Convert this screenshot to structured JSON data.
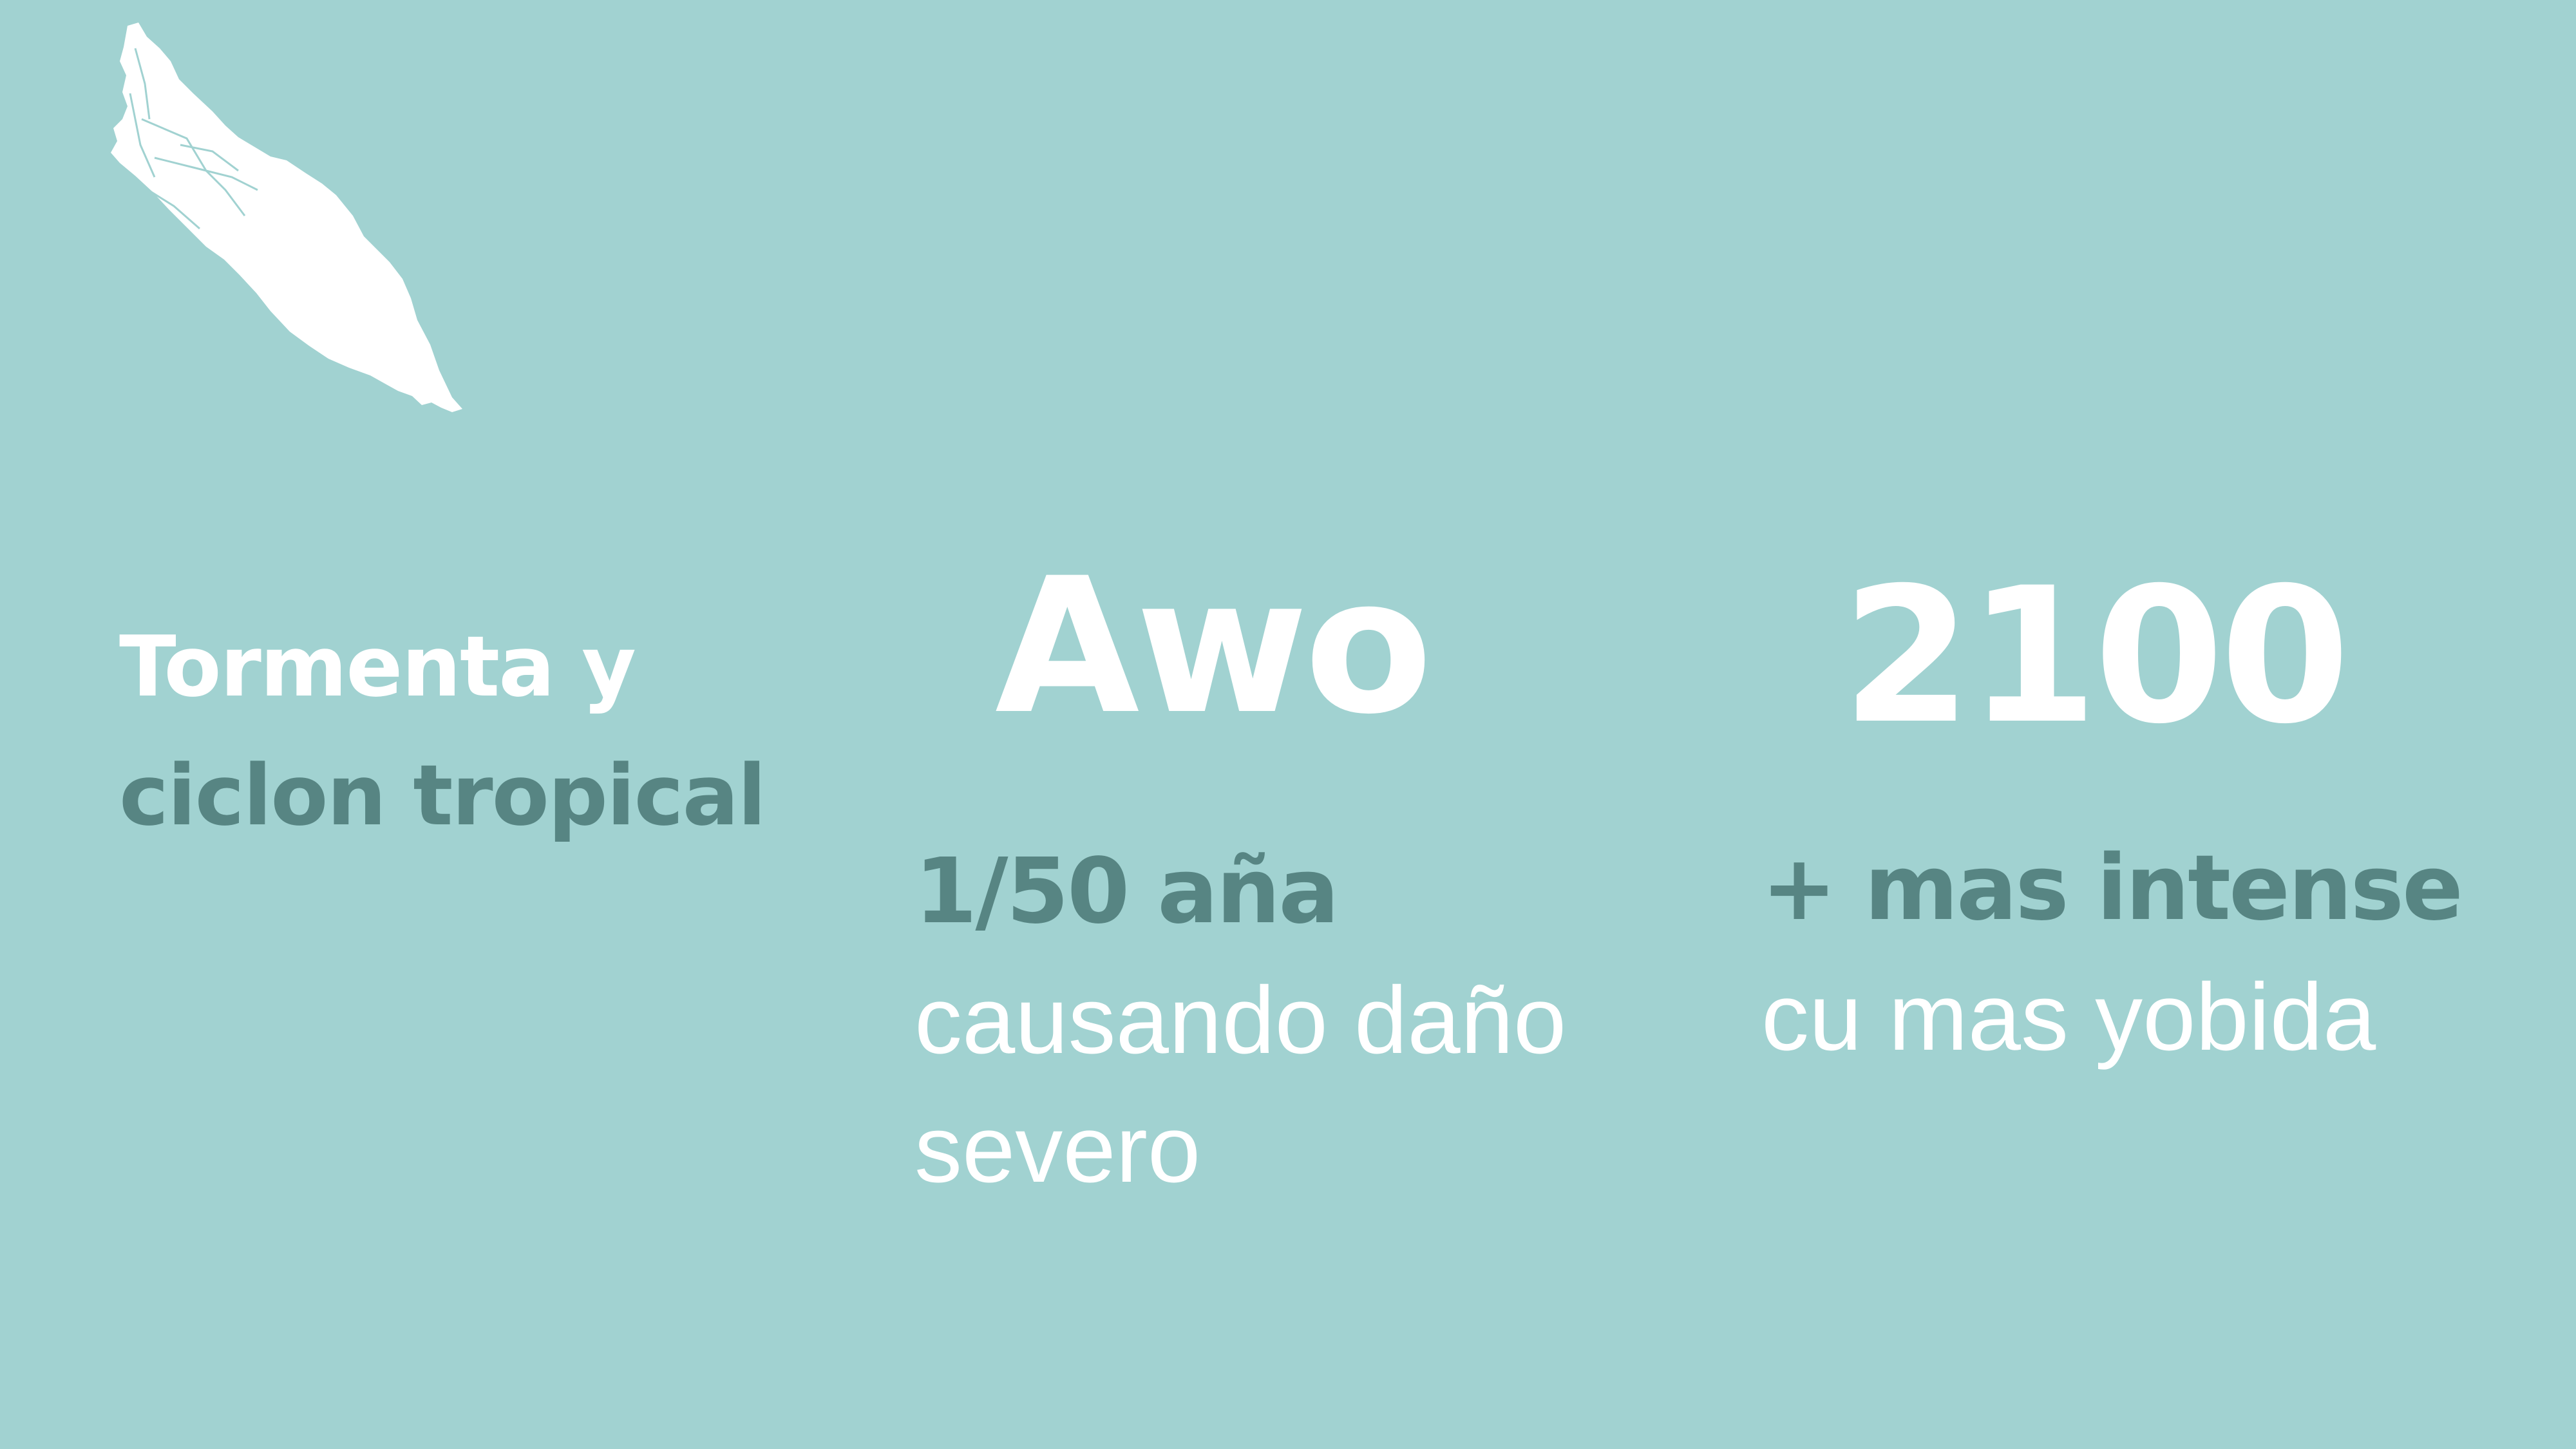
{
  "hazard": {
    "title_line1": "Tormenta y",
    "title_line2": "ciclon tropical"
  },
  "current": {
    "label": "Awo",
    "frequency": "1/50 aña",
    "desc_line1": "causando daño",
    "desc_line2": "severo"
  },
  "future": {
    "label": "2100",
    "change": "+ mas intense",
    "desc_line1": "cu mas yobida"
  },
  "colors": {
    "background": "#a1d2d1",
    "white_text": "#ffffff",
    "accent_text": "#578583"
  },
  "icons": {
    "map": "island-map-icon"
  }
}
